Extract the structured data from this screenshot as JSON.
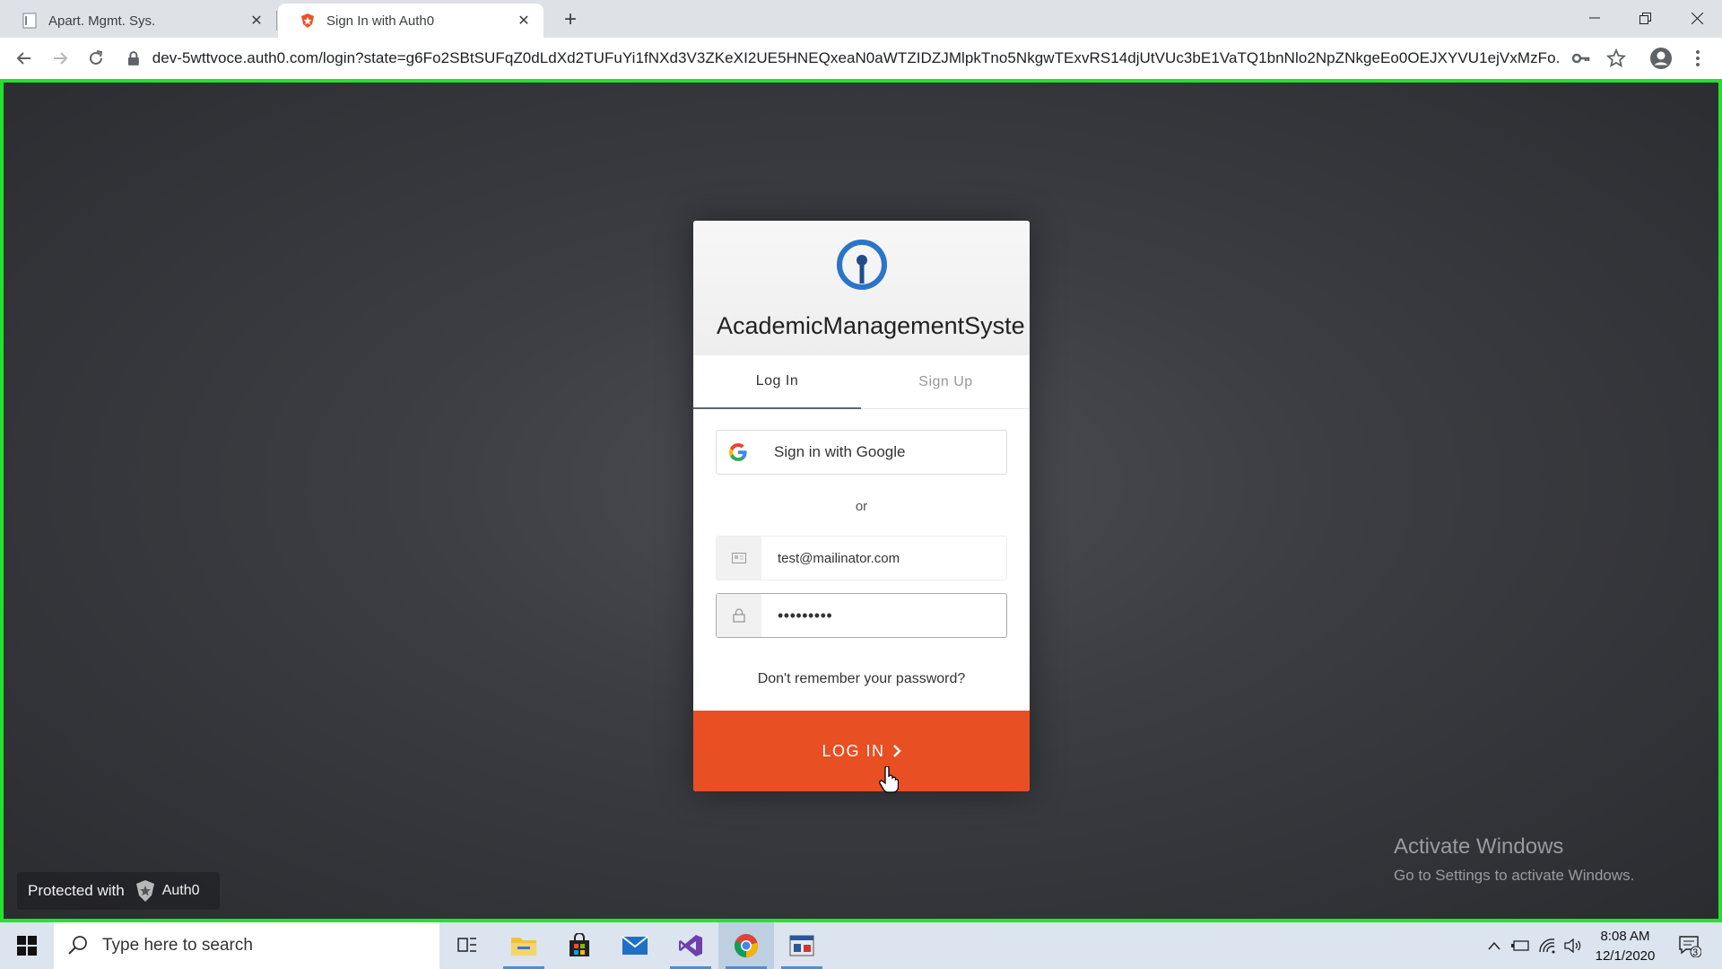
{
  "browser": {
    "tabs": [
      {
        "title": "Apart. Mgmt. Sys.",
        "active": false
      },
      {
        "title": "Sign In with Auth0",
        "active": true
      }
    ],
    "url": "dev-5wttvoce.auth0.com/login?state=g6Fo2SBtSUFqZ0dLdXd2TUFuYi1fNXd3V3ZKeXI2UE5HNEQxeaN0aWTZIDZJMlpkTno5NkgwTExvRS14djUtVUc3bE1VaTQ1bnNlo2NpZNkgeEo0OEJXYVU1ejVxMzFo..."
  },
  "login_card": {
    "app_name": "AcademicManagementSyste",
    "tab_login": "Log In",
    "tab_signup": "Sign Up",
    "google_label": "Sign in with Google",
    "or_text": "or",
    "email_value": "test@mailinator.com",
    "password_value": "•••••••••",
    "forgot_text": "Don't remember your password?",
    "login_button": "LOG IN",
    "accent_color": "#e84f22"
  },
  "footer": {
    "protected_with": "Protected with",
    "brand": "Auth0"
  },
  "watermark": {
    "line1": "Activate Windows",
    "line2": "Go to Settings to activate Windows."
  },
  "taskbar": {
    "search_placeholder": "Type here to search",
    "time": "8:08 AM",
    "date": "12/1/2020",
    "notifications": "3"
  }
}
